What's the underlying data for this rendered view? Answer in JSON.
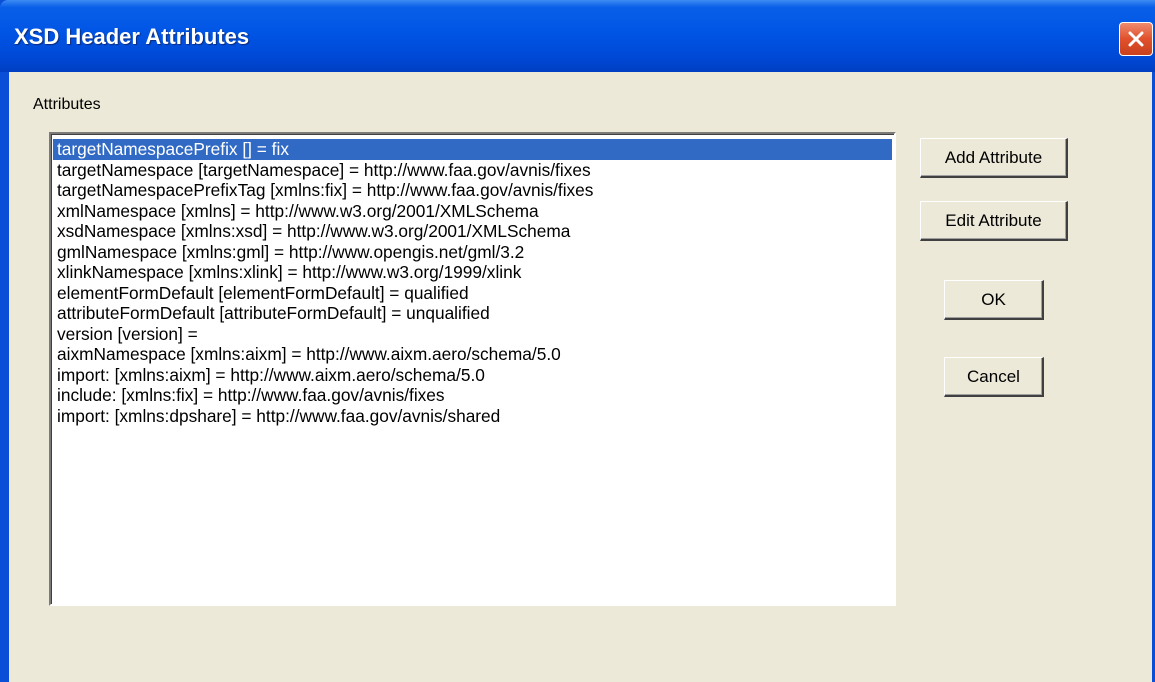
{
  "window": {
    "title": "XSD Header Attributes",
    "accent_color": "#0a4fd8",
    "close_icon": "close-icon"
  },
  "attributes": {
    "label": "Attributes",
    "items": [
      {
        "text": "targetNamespacePrefix [] = fix",
        "selected": true
      },
      {
        "text": "targetNamespace [targetNamespace] = http://www.faa.gov/avnis/fixes",
        "selected": false
      },
      {
        "text": "targetNamespacePrefixTag [xmlns:fix] = http://www.faa.gov/avnis/fixes",
        "selected": false
      },
      {
        "text": "xmlNamespace [xmlns] = http://www.w3.org/2001/XMLSchema",
        "selected": false
      },
      {
        "text": "xsdNamespace [xmlns:xsd] = http://www.w3.org/2001/XMLSchema",
        "selected": false
      },
      {
        "text": "gmlNamespace [xmlns:gml] = http://www.opengis.net/gml/3.2",
        "selected": false
      },
      {
        "text": "xlinkNamespace [xmlns:xlink] = http://www.w3.org/1999/xlink",
        "selected": false
      },
      {
        "text": "elementFormDefault [elementFormDefault] = qualified",
        "selected": false
      },
      {
        "text": "attributeFormDefault [attributeFormDefault] = unqualified",
        "selected": false
      },
      {
        "text": "version [version] =",
        "selected": false
      },
      {
        "text": "aixmNamespace [xmlns:aixm] = http://www.aixm.aero/schema/5.0",
        "selected": false
      },
      {
        "text": "import: [xmlns:aixm] = http://www.aixm.aero/schema/5.0",
        "selected": false
      },
      {
        "text": "include: [xmlns:fix] = http://www.faa.gov/avnis/fixes",
        "selected": false
      },
      {
        "text": "import: [xmlns:dpshare] = http://www.faa.gov/avnis/shared",
        "selected": false
      }
    ],
    "selection_color": "#316ac5"
  },
  "buttons": {
    "add_attribute": "Add Attribute",
    "edit_attribute": "Edit Attribute",
    "ok": "OK",
    "cancel": "Cancel"
  }
}
